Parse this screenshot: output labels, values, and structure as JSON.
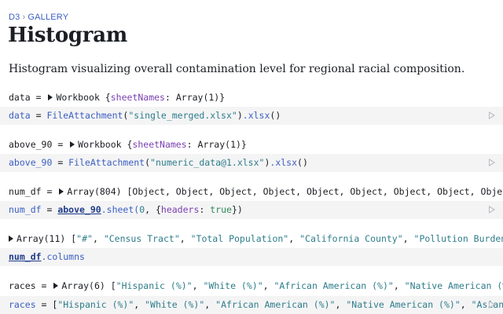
{
  "breadcrumb": {
    "root": "D3",
    "separator": "›",
    "current": "GALLERY"
  },
  "title": "Histogram",
  "description": "Histogram visualizing overall contamination level for regional racial composition.",
  "cells": [
    {
      "output": {
        "name": "data",
        "eq": " = ",
        "kind": "Workbook",
        "brace_open": " {",
        "key": "sheetNames",
        "colon": ": ",
        "value": "Array(1)",
        "brace_close": "}"
      },
      "code": {
        "var": "data",
        "eq": " = ",
        "fn": "FileAttachment",
        "paren_open": "(",
        "arg": "\"single_merged.xlsx\"",
        "paren_close": ")",
        "method": ".xlsx",
        "call": "()"
      }
    },
    {
      "output": {
        "name": "above_90",
        "eq": " = ",
        "kind": "Workbook",
        "brace_open": " {",
        "key": "sheetNames",
        "colon": ": ",
        "value": "Array(1)",
        "brace_close": "}"
      },
      "code": {
        "var": "above_90",
        "eq": " = ",
        "fn": "FileAttachment",
        "paren_open": "(",
        "arg": "\"numeric_data@1.xlsx\"",
        "paren_close": ")",
        "method": ".xlsx",
        "call": "()"
      }
    },
    {
      "output": {
        "name": "num_df",
        "eq": " = ",
        "text": "Array(804) [Object, Object, Object, Object, Object, Object, Object, Object, Object, Ob"
      },
      "code": {
        "var": "num_df",
        "eq": " = ",
        "ref": "above_90",
        "method": ".sheet(",
        "n": "0",
        "comma": ", {",
        "key": "headers",
        "colon": ": ",
        "val": "true",
        "close": "})"
      }
    },
    {
      "output": {
        "text": "Array(11) [",
        "items": [
          "\"#\"",
          ", ",
          "\"Census Tract\"",
          ", ",
          "\"Total Population\"",
          ", ",
          "\"California County\"",
          ", ",
          "\"Pollution Burden Pctl"
        ]
      },
      "code": {
        "ref": "num_df",
        "method": ".columns"
      }
    },
    {
      "output": {
        "name": "races",
        "eq": " = ",
        "text": "Array(6) [",
        "items": [
          "\"Hispanic (%)\"",
          ", ",
          "\"White (%)\"",
          ", ",
          "\"African American (%)\"",
          ", ",
          "\"Native American (%)\"",
          ", \""
        ]
      },
      "code": {
        "var": "races",
        "eq": " = [",
        "items": [
          "\"Hispanic (%)\"",
          ", ",
          "\"White (%)\"",
          ", ",
          "\"African American (%)\"",
          ", ",
          "\"Native American (%)\"",
          ", ",
          "\"Asian"
        ]
      }
    }
  ],
  "icons": {
    "run": "play-icon",
    "expand": "disclosure-triangle-icon"
  }
}
